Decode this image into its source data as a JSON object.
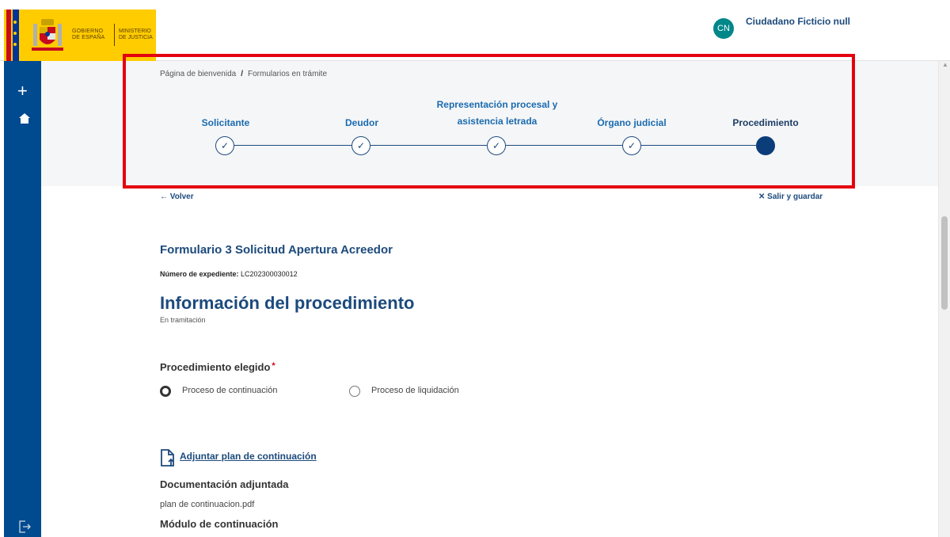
{
  "header": {
    "gov_line1": "GOBIERNO",
    "gov_line2": "DE ESPAÑA",
    "ministry_line1": "MINISTERIO",
    "ministry_line2": "DE JUSTICIA",
    "user_initials": "CN",
    "user_name": "Ciudadano Ficticio null"
  },
  "sidebar": {
    "add_icon": "plus-icon",
    "home_icon": "home-icon",
    "logout_icon": "logout-icon"
  },
  "breadcrumb": {
    "items": [
      "Página de bienvenida",
      "Formularios en trámite"
    ],
    "separator": "/"
  },
  "stepper": {
    "steps": [
      {
        "label": "Solicitante",
        "status": "completed"
      },
      {
        "label": "Deudor",
        "status": "completed"
      },
      {
        "label_line1": "Representación procesal y",
        "label_line2": "asistencia letrada",
        "status": "completed"
      },
      {
        "label": "Órgano judicial",
        "status": "completed"
      },
      {
        "label": "Procedimiento",
        "status": "current"
      }
    ],
    "check_glyph": "✓"
  },
  "nav": {
    "back_label": "← Volver",
    "exit_label": "✕ Salir y guardar"
  },
  "form": {
    "title": "Formulario 3  Solicitud Apertura Acreedor",
    "expediente_label": "Número de expediente:",
    "expediente_value": "LC202300030012",
    "section_title": "Información del procedimiento",
    "section_status": "En tramitación",
    "procedure_label": "Procedimiento elegido",
    "required_mark": "*",
    "options": [
      {
        "label": "Proceso de continuación",
        "selected": true
      },
      {
        "label": "Proceso de liquidación",
        "selected": false
      }
    ],
    "attach_label": "Adjuntar plan de continuación",
    "docs_title": "Documentación adjuntada",
    "doc_file": "plan de continuacion.pdf",
    "module_title": "Módulo de continuación"
  },
  "colors": {
    "accent": "#1c4a7c",
    "sidebar": "#004a8f",
    "highlight": "#e5000f",
    "avatar": "#00878a"
  }
}
